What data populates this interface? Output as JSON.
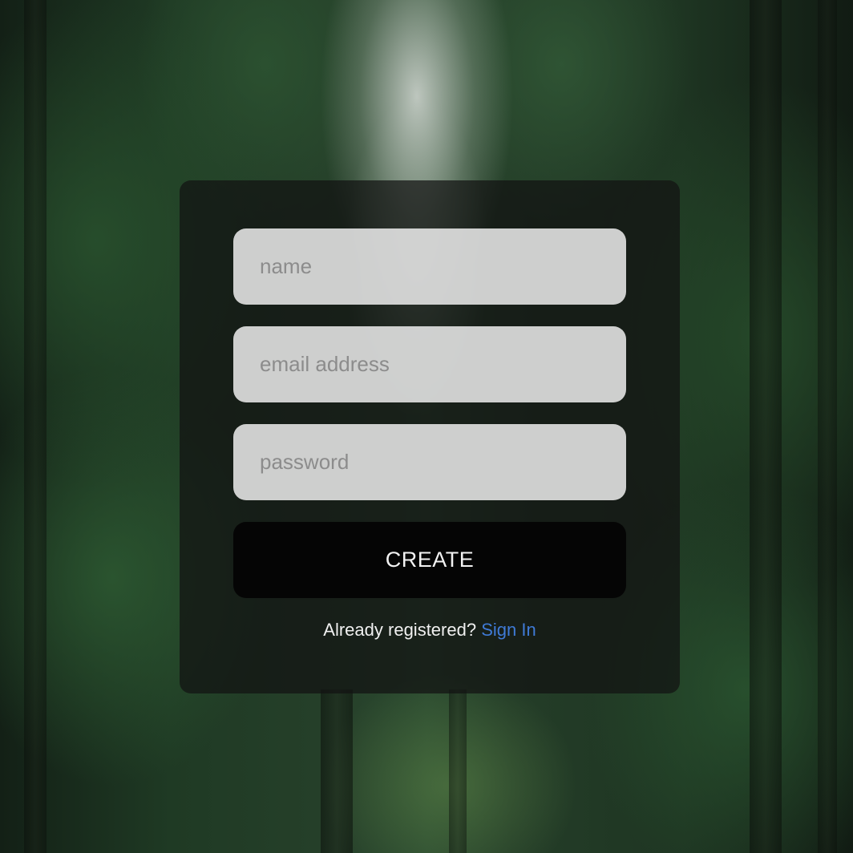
{
  "form": {
    "name_placeholder": "name",
    "email_placeholder": "email address",
    "password_placeholder": "password",
    "create_label": "CREATE",
    "already_registered_text": "Already registered?",
    "signin_label": "Sign In"
  },
  "colors": {
    "link": "#3f7ad6",
    "button_bg": "#050505",
    "card_bg": "rgba(18,18,18,0.72)"
  }
}
